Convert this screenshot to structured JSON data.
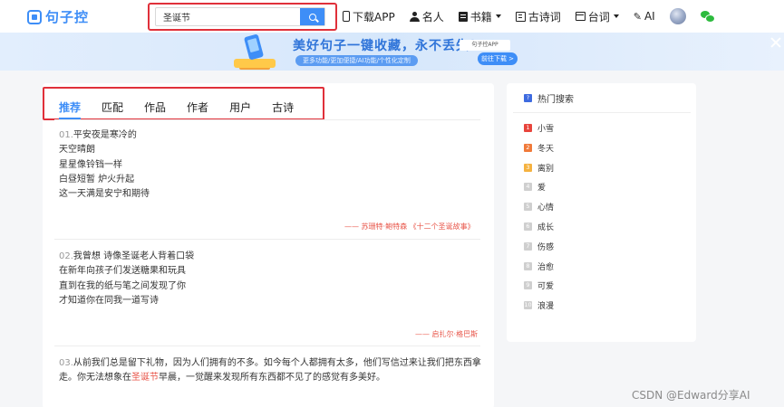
{
  "logo": {
    "text": "句子控"
  },
  "search": {
    "value": "圣诞节"
  },
  "nav": [
    {
      "label": "下载APP",
      "icon": "phone-icon"
    },
    {
      "label": "名人",
      "icon": "person-icon"
    },
    {
      "label": "书籍",
      "icon": "book-icon"
    },
    {
      "label": "古诗词",
      "icon": "poem-icon"
    },
    {
      "label": "台词",
      "icon": "tv-icon"
    },
    {
      "label": "AI",
      "icon": "ai-icon"
    }
  ],
  "banner": {
    "title": "美好句子一键收藏，永不丢失！",
    "subtitle": "更多功能/更加便捷/AI功能/个性化定制",
    "app_badge": "句子控APP",
    "button": "前往下载 >"
  },
  "tabs": [
    "推荐",
    "匹配",
    "作品",
    "作者",
    "用户",
    "古诗"
  ],
  "entries": [
    {
      "num": "01.",
      "lines": [
        "平安夜是寒冷的",
        "天空晴朗",
        "星星像铃铛一样",
        "白昼短暂 炉火升起",
        "这一天满是安宁和期待"
      ],
      "source": "—— 苏珊特·鲍特森 《十二个圣诞故事》"
    },
    {
      "num": "02.",
      "lines": [
        "我曾想 诗像圣诞老人背着口袋",
        "在新年向孩子们发送糖果和玩具",
        "直到在我的纸与笔之间发现了你",
        "才知道你在同我一道写诗"
      ],
      "source": "—— 启扎尔·格巴斯"
    },
    {
      "num": "03.",
      "line1": "从前我们总是留下礼物，因为人们拥有的不多。如今每个人都拥有太多，他们写信过来让我们把东西拿",
      "line2_before": "走。你无法想象在",
      "line2_highlight": "圣诞节",
      "line2_after": "早晨，一觉醒来发现所有东西都不见了的感觉有多美好。"
    }
  ],
  "sidebar": {
    "title": "热门搜索",
    "title_icon": "?",
    "items": [
      {
        "rank": "1",
        "label": "小雪",
        "color": "#e8453c"
      },
      {
        "rank": "2",
        "label": "冬天",
        "color": "#f07a3a"
      },
      {
        "rank": "3",
        "label": "离别",
        "color": "#f5b240"
      },
      {
        "rank": "4",
        "label": "爱",
        "color": "#cfcfcf"
      },
      {
        "rank": "5",
        "label": "心情",
        "color": "#cfcfcf"
      },
      {
        "rank": "6",
        "label": "成长",
        "color": "#cfcfcf"
      },
      {
        "rank": "7",
        "label": "伤感",
        "color": "#cfcfcf"
      },
      {
        "rank": "8",
        "label": "治愈",
        "color": "#cfcfcf"
      },
      {
        "rank": "9",
        "label": "可爱",
        "color": "#cfcfcf"
      },
      {
        "rank": "10",
        "label": "浪漫",
        "color": "#cfcfcf"
      }
    ]
  },
  "watermark": "CSDN @Edward分享AI",
  "colors": {
    "accent": "#3e8ef7",
    "highlight_box": "#e0303a",
    "quote_red": "#e8564a"
  }
}
